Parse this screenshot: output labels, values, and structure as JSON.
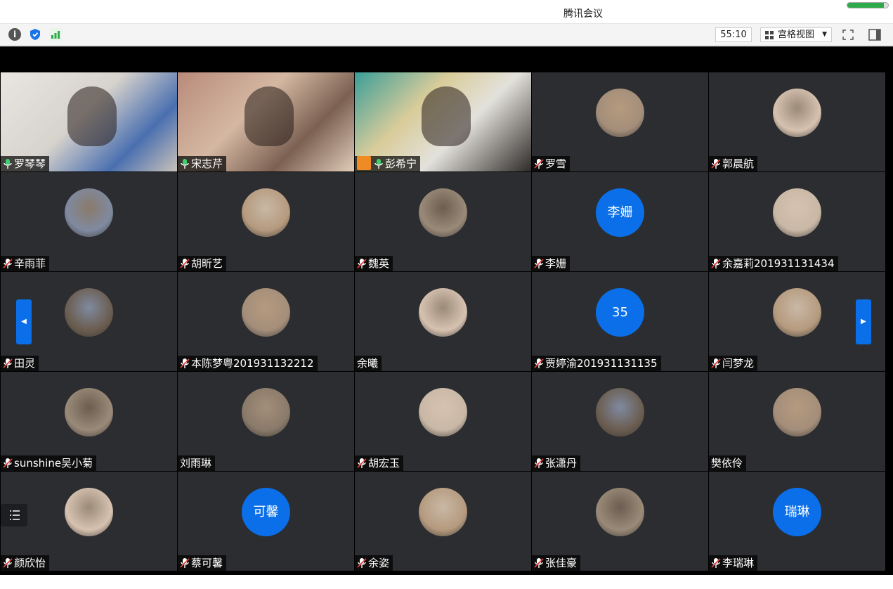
{
  "window": {
    "title": "腾讯会议",
    "signal_level": 0.9
  },
  "toolbar": {
    "info_label": "i",
    "timer": "55:10",
    "view_label": "宫格视图",
    "icons": [
      "info-icon",
      "shield-icon",
      "signal-icon",
      "grid-view-icon",
      "fullscreen-icon",
      "side-panel-icon"
    ]
  },
  "colors": {
    "accent": "#0a6fe8",
    "tile_bg": "#2c2d30",
    "active_border": "#35c35a",
    "host_badge": "#f08a24"
  },
  "participants": [
    {
      "name": "罗琴琴",
      "mic": "on",
      "kind": "video"
    },
    {
      "name": "宋志芹",
      "mic": "on",
      "kind": "video",
      "active": true
    },
    {
      "name": "彭希宁",
      "mic": "on",
      "kind": "video",
      "host": true
    },
    {
      "name": "罗雪",
      "mic": "muted",
      "kind": "photo"
    },
    {
      "name": "郭晨航",
      "mic": "muted",
      "kind": "photo"
    },
    {
      "name": "辛雨菲",
      "mic": "muted",
      "kind": "photo"
    },
    {
      "name": "胡昕艺",
      "mic": "muted",
      "kind": "photo"
    },
    {
      "name": "魏英",
      "mic": "muted",
      "kind": "photo"
    },
    {
      "name": "李姗",
      "mic": "muted",
      "kind": "text",
      "avatar_text": "李姗"
    },
    {
      "name": "余嘉莉201931131434",
      "mic": "muted",
      "kind": "photo"
    },
    {
      "name": "田灵",
      "mic": "muted",
      "kind": "photo"
    },
    {
      "name": "本陈梦粤201931132212",
      "mic": "muted",
      "kind": "photo"
    },
    {
      "name": "余曦",
      "mic": "none",
      "kind": "photo"
    },
    {
      "name": "贾婷渝201931131135",
      "mic": "muted",
      "kind": "text",
      "avatar_text": "35"
    },
    {
      "name": "闫梦龙",
      "mic": "muted",
      "kind": "photo"
    },
    {
      "name": "sunshine吴小菊",
      "mic": "muted",
      "kind": "photo"
    },
    {
      "name": "刘雨琳",
      "mic": "none",
      "kind": "photo"
    },
    {
      "name": "胡宏玉",
      "mic": "muted",
      "kind": "photo"
    },
    {
      "name": "张潇丹",
      "mic": "muted",
      "kind": "photo"
    },
    {
      "name": "樊依伶",
      "mic": "none",
      "kind": "photo"
    },
    {
      "name": "颜欣怡",
      "mic": "muted",
      "kind": "photo"
    },
    {
      "name": "蔡可馨",
      "mic": "muted",
      "kind": "text",
      "avatar_text": "可馨"
    },
    {
      "name": "余姿",
      "mic": "muted",
      "kind": "photo"
    },
    {
      "name": "张佳豪",
      "mic": "muted",
      "kind": "photo"
    },
    {
      "name": "李瑞琳",
      "mic": "muted",
      "kind": "text",
      "avatar_text": "瑞琳"
    }
  ],
  "pager": {
    "prev_icon": "chevron-left-icon",
    "next_icon": "chevron-right-icon"
  },
  "menu": {
    "icon": "list-menu-icon"
  }
}
